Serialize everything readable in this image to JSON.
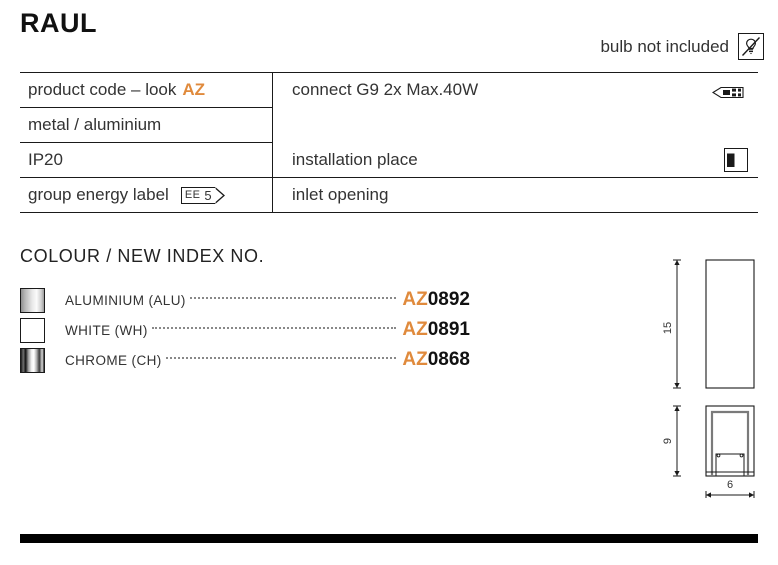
{
  "product": {
    "title": "RAUL",
    "accent_color": "#E08A3C"
  },
  "bulb_note": {
    "text": "bulb not included",
    "icon": "bulb-crossed-out-icon"
  },
  "spec_table": {
    "left_column": [
      {
        "label": "product code – look",
        "accent": "AZ"
      },
      {
        "label": "metal / aluminium"
      },
      {
        "label": "IP20"
      },
      {
        "label": "group energy label",
        "badge": {
          "prefix": "EE",
          "value": "5"
        }
      }
    ],
    "right_column": [
      {
        "label": "connect G9 2x Max.40W",
        "icon": "g9-capsule-bulb-icon"
      },
      {
        "label": ""
      },
      {
        "label": "installation place",
        "icon": "wall-mount-icon"
      },
      {
        "label": "inlet opening"
      }
    ]
  },
  "colour_section": {
    "heading": "COLOUR / NEW INDEX NO.",
    "items": [
      {
        "name": "ALUMINIUM (ALU)",
        "prefix": "AZ",
        "code": "0892",
        "swatch": "aluminium-swatch"
      },
      {
        "name": "WHITE (WH)",
        "prefix": "AZ",
        "code": "0891",
        "swatch": "white-swatch"
      },
      {
        "name": "CHROME (CH)",
        "prefix": "AZ",
        "code": "0868",
        "swatch": "chrome-swatch"
      }
    ]
  },
  "tech_drawing": {
    "height_top": "15",
    "height_bottom": "9",
    "width": "6"
  }
}
